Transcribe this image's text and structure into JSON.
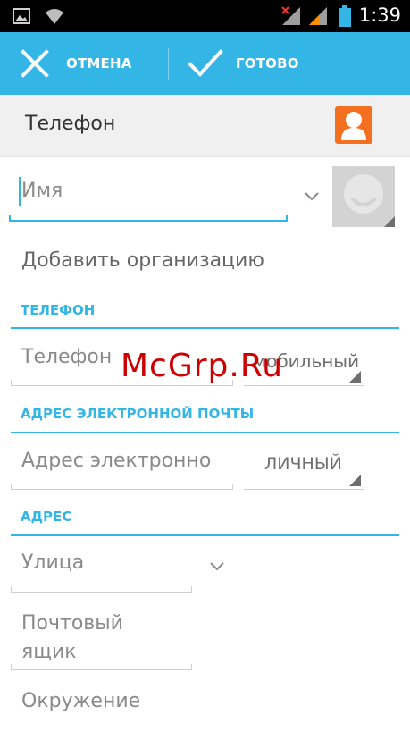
{
  "status_bar": {
    "time": "1:39",
    "icons": [
      "image-icon",
      "wifi-icon",
      "signal-no-sim-icon",
      "signal-icon",
      "battery-icon"
    ]
  },
  "action_bar": {
    "cancel_label": "ОТМЕНА",
    "done_label": "ГОТОВО",
    "accent": "#33b5e5"
  },
  "account": {
    "title": "Телефон",
    "icon_color": "#f37021"
  },
  "name": {
    "placeholder": "Имя"
  },
  "organization": {
    "label": "Добавить организацию"
  },
  "phone": {
    "header": "ТЕЛЕФОН",
    "placeholder": "Телефон",
    "type": "мобильный"
  },
  "email": {
    "header": "АДРЕС ЭЛЕКТРОННОЙ ПОЧТЫ",
    "placeholder": "Адрес электронно",
    "type": "ЛИЧНЫЙ"
  },
  "address": {
    "header": "АДРЕС",
    "street_placeholder": "Улица",
    "pobox_line1": "Почтовый",
    "pobox_line2": "ящик",
    "neighborhood_placeholder": "Окружение"
  },
  "watermark": "McGrp.Ru"
}
